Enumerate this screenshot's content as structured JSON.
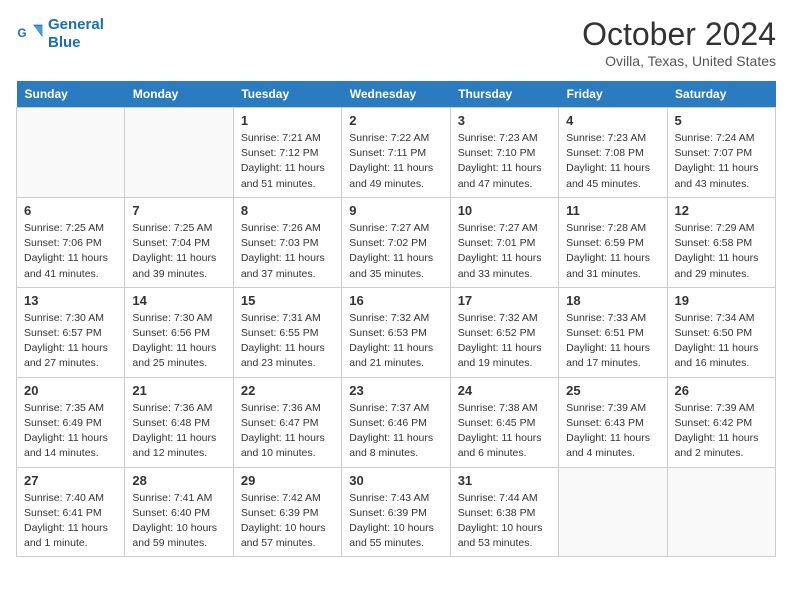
{
  "header": {
    "logo_line1": "General",
    "logo_line2": "Blue",
    "month": "October 2024",
    "location": "Ovilla, Texas, United States"
  },
  "weekdays": [
    "Sunday",
    "Monday",
    "Tuesday",
    "Wednesday",
    "Thursday",
    "Friday",
    "Saturday"
  ],
  "weeks": [
    [
      {
        "day": "",
        "empty": true
      },
      {
        "day": "",
        "empty": true
      },
      {
        "day": "1",
        "sunrise": "Sunrise: 7:21 AM",
        "sunset": "Sunset: 7:12 PM",
        "daylight": "Daylight: 11 hours and 51 minutes."
      },
      {
        "day": "2",
        "sunrise": "Sunrise: 7:22 AM",
        "sunset": "Sunset: 7:11 PM",
        "daylight": "Daylight: 11 hours and 49 minutes."
      },
      {
        "day": "3",
        "sunrise": "Sunrise: 7:23 AM",
        "sunset": "Sunset: 7:10 PM",
        "daylight": "Daylight: 11 hours and 47 minutes."
      },
      {
        "day": "4",
        "sunrise": "Sunrise: 7:23 AM",
        "sunset": "Sunset: 7:08 PM",
        "daylight": "Daylight: 11 hours and 45 minutes."
      },
      {
        "day": "5",
        "sunrise": "Sunrise: 7:24 AM",
        "sunset": "Sunset: 7:07 PM",
        "daylight": "Daylight: 11 hours and 43 minutes."
      }
    ],
    [
      {
        "day": "6",
        "sunrise": "Sunrise: 7:25 AM",
        "sunset": "Sunset: 7:06 PM",
        "daylight": "Daylight: 11 hours and 41 minutes."
      },
      {
        "day": "7",
        "sunrise": "Sunrise: 7:25 AM",
        "sunset": "Sunset: 7:04 PM",
        "daylight": "Daylight: 11 hours and 39 minutes."
      },
      {
        "day": "8",
        "sunrise": "Sunrise: 7:26 AM",
        "sunset": "Sunset: 7:03 PM",
        "daylight": "Daylight: 11 hours and 37 minutes."
      },
      {
        "day": "9",
        "sunrise": "Sunrise: 7:27 AM",
        "sunset": "Sunset: 7:02 PM",
        "daylight": "Daylight: 11 hours and 35 minutes."
      },
      {
        "day": "10",
        "sunrise": "Sunrise: 7:27 AM",
        "sunset": "Sunset: 7:01 PM",
        "daylight": "Daylight: 11 hours and 33 minutes."
      },
      {
        "day": "11",
        "sunrise": "Sunrise: 7:28 AM",
        "sunset": "Sunset: 6:59 PM",
        "daylight": "Daylight: 11 hours and 31 minutes."
      },
      {
        "day": "12",
        "sunrise": "Sunrise: 7:29 AM",
        "sunset": "Sunset: 6:58 PM",
        "daylight": "Daylight: 11 hours and 29 minutes."
      }
    ],
    [
      {
        "day": "13",
        "sunrise": "Sunrise: 7:30 AM",
        "sunset": "Sunset: 6:57 PM",
        "daylight": "Daylight: 11 hours and 27 minutes."
      },
      {
        "day": "14",
        "sunrise": "Sunrise: 7:30 AM",
        "sunset": "Sunset: 6:56 PM",
        "daylight": "Daylight: 11 hours and 25 minutes."
      },
      {
        "day": "15",
        "sunrise": "Sunrise: 7:31 AM",
        "sunset": "Sunset: 6:55 PM",
        "daylight": "Daylight: 11 hours and 23 minutes."
      },
      {
        "day": "16",
        "sunrise": "Sunrise: 7:32 AM",
        "sunset": "Sunset: 6:53 PM",
        "daylight": "Daylight: 11 hours and 21 minutes."
      },
      {
        "day": "17",
        "sunrise": "Sunrise: 7:32 AM",
        "sunset": "Sunset: 6:52 PM",
        "daylight": "Daylight: 11 hours and 19 minutes."
      },
      {
        "day": "18",
        "sunrise": "Sunrise: 7:33 AM",
        "sunset": "Sunset: 6:51 PM",
        "daylight": "Daylight: 11 hours and 17 minutes."
      },
      {
        "day": "19",
        "sunrise": "Sunrise: 7:34 AM",
        "sunset": "Sunset: 6:50 PM",
        "daylight": "Daylight: 11 hours and 16 minutes."
      }
    ],
    [
      {
        "day": "20",
        "sunrise": "Sunrise: 7:35 AM",
        "sunset": "Sunset: 6:49 PM",
        "daylight": "Daylight: 11 hours and 14 minutes."
      },
      {
        "day": "21",
        "sunrise": "Sunrise: 7:36 AM",
        "sunset": "Sunset: 6:48 PM",
        "daylight": "Daylight: 11 hours and 12 minutes."
      },
      {
        "day": "22",
        "sunrise": "Sunrise: 7:36 AM",
        "sunset": "Sunset: 6:47 PM",
        "daylight": "Daylight: 11 hours and 10 minutes."
      },
      {
        "day": "23",
        "sunrise": "Sunrise: 7:37 AM",
        "sunset": "Sunset: 6:46 PM",
        "daylight": "Daylight: 11 hours and 8 minutes."
      },
      {
        "day": "24",
        "sunrise": "Sunrise: 7:38 AM",
        "sunset": "Sunset: 6:45 PM",
        "daylight": "Daylight: 11 hours and 6 minutes."
      },
      {
        "day": "25",
        "sunrise": "Sunrise: 7:39 AM",
        "sunset": "Sunset: 6:43 PM",
        "daylight": "Daylight: 11 hours and 4 minutes."
      },
      {
        "day": "26",
        "sunrise": "Sunrise: 7:39 AM",
        "sunset": "Sunset: 6:42 PM",
        "daylight": "Daylight: 11 hours and 2 minutes."
      }
    ],
    [
      {
        "day": "27",
        "sunrise": "Sunrise: 7:40 AM",
        "sunset": "Sunset: 6:41 PM",
        "daylight": "Daylight: 11 hours and 1 minute."
      },
      {
        "day": "28",
        "sunrise": "Sunrise: 7:41 AM",
        "sunset": "Sunset: 6:40 PM",
        "daylight": "Daylight: 10 hours and 59 minutes."
      },
      {
        "day": "29",
        "sunrise": "Sunrise: 7:42 AM",
        "sunset": "Sunset: 6:39 PM",
        "daylight": "Daylight: 10 hours and 57 minutes."
      },
      {
        "day": "30",
        "sunrise": "Sunrise: 7:43 AM",
        "sunset": "Sunset: 6:39 PM",
        "daylight": "Daylight: 10 hours and 55 minutes."
      },
      {
        "day": "31",
        "sunrise": "Sunrise: 7:44 AM",
        "sunset": "Sunset: 6:38 PM",
        "daylight": "Daylight: 10 hours and 53 minutes."
      },
      {
        "day": "",
        "empty": true
      },
      {
        "day": "",
        "empty": true
      }
    ]
  ]
}
